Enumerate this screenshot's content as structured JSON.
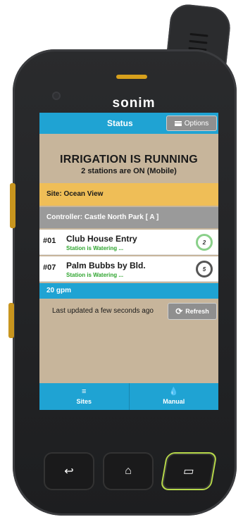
{
  "device": {
    "brand": "sonim"
  },
  "header": {
    "title": "Status",
    "options_label": "Options"
  },
  "banner": {
    "title": "IRRIGATION IS RUNNING",
    "subtitle": "2 stations are ON (Mobile)"
  },
  "site": {
    "label": "Site: Ocean View"
  },
  "controller": {
    "label": "Controller: Castle North Park [ A ]"
  },
  "stations": [
    {
      "number": "#01",
      "name": "Club House Entry",
      "status": "Station is Watering ...",
      "remaining": "2",
      "progress": 0.1,
      "ring_color": "#8ad08a"
    },
    {
      "number": "#07",
      "name": "Palm Bubbs by Bld.",
      "status": "Station is Watering ...",
      "remaining": "5",
      "progress": 0.1,
      "ring_color": "#555555"
    }
  ],
  "flow": {
    "label": "20 gpm"
  },
  "update": {
    "text": "Last updated a few seconds ago",
    "refresh_label": "Refresh"
  },
  "nav": {
    "sites_label": "Sites",
    "manual_label": "Manual"
  },
  "colors": {
    "accent": "#1fa3d3",
    "site_bar": "#efbe57",
    "controller_bar": "#9a9a9a",
    "background": "#c7b59b",
    "status_green": "#2fa52f"
  }
}
